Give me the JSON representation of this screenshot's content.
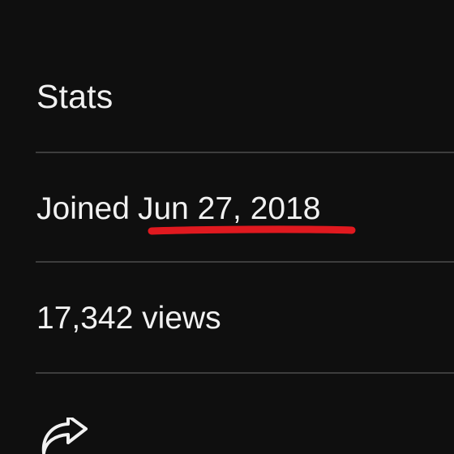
{
  "stats": {
    "title": "Stats",
    "joined_prefix": "Joined",
    "joined_date": "Jun 27, 2018",
    "views": "17,342 views"
  },
  "annotation": {
    "color": "#e0191f"
  },
  "actions": {
    "share_icon": "share-arrow-icon"
  },
  "colors": {
    "background": "#0f0f0f",
    "text": "#f1f1f1",
    "divider": "#3d3d3d"
  }
}
